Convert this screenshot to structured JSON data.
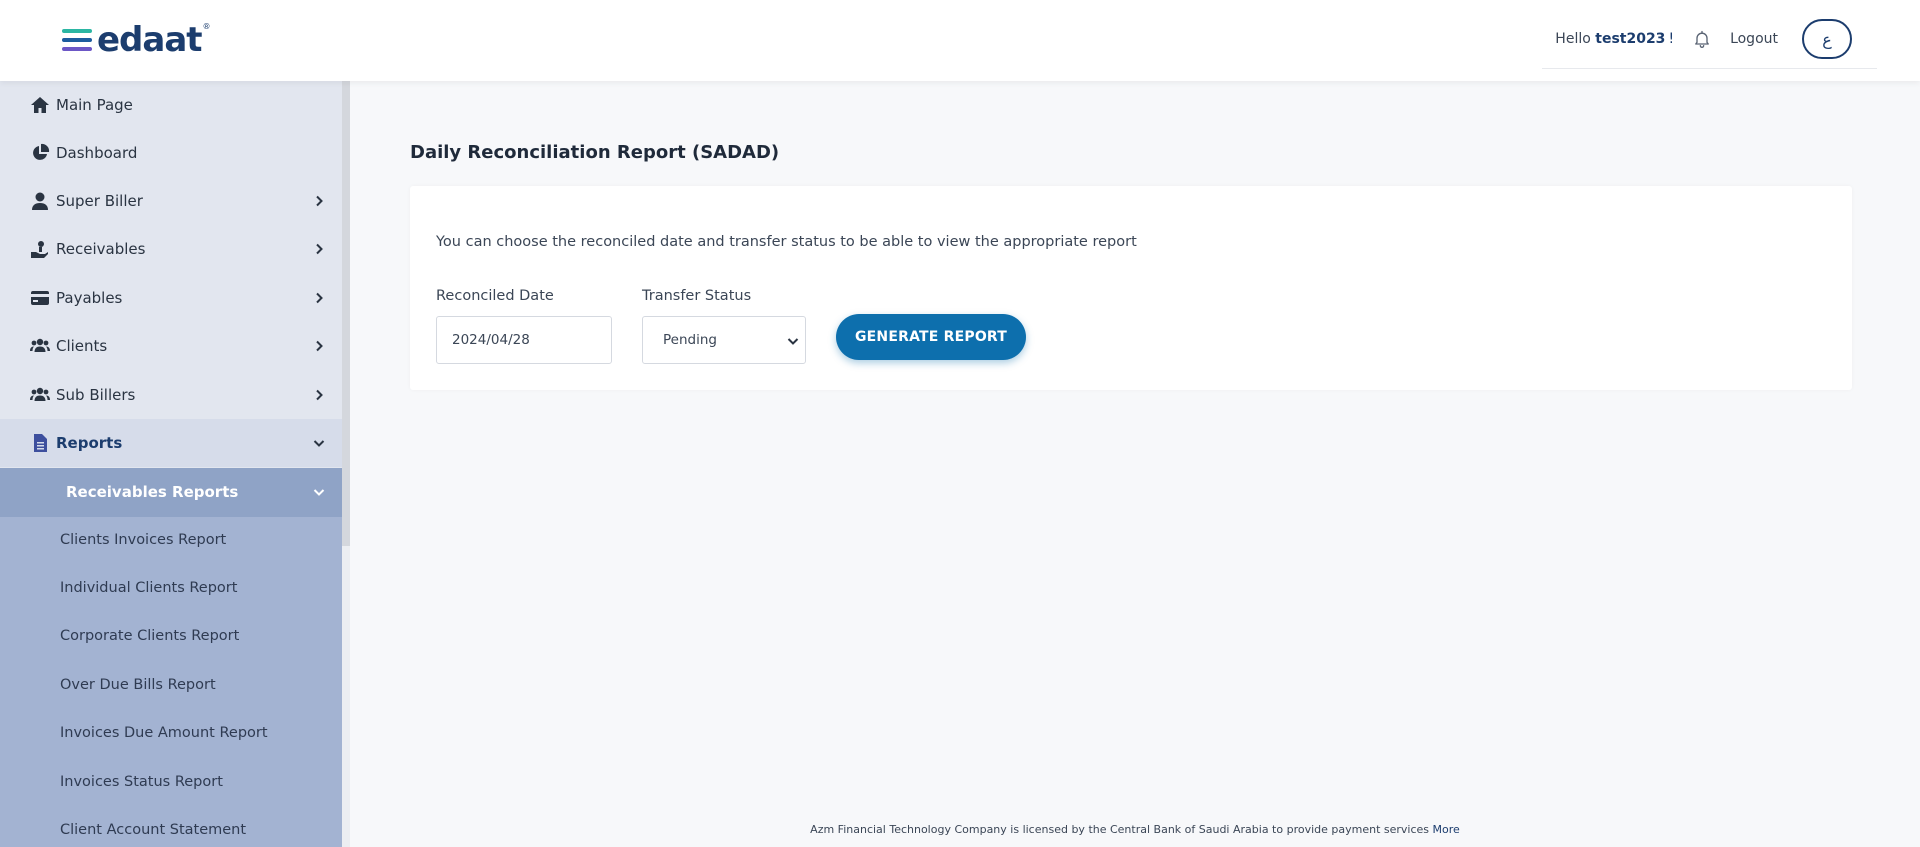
{
  "brand": {
    "logo_text": "edaat",
    "logo_tm": "®",
    "bar_colors": [
      "#2bb6a3",
      "#1c5c9e",
      "#6c57c6"
    ]
  },
  "header": {
    "greeting": "Hello",
    "username": "test2023",
    "greeting_suffix": "!",
    "logout_label": "Logout",
    "language_label": "ع"
  },
  "sidebar": {
    "items": [
      {
        "label": "Main Page",
        "icon": "home-icon",
        "has_chevron": false
      },
      {
        "label": "Dashboard",
        "icon": "pie-chart-icon",
        "has_chevron": false
      },
      {
        "label": "Super Biller",
        "icon": "user-icon",
        "has_chevron": true
      },
      {
        "label": "Receivables",
        "icon": "hand-coin-icon",
        "has_chevron": true
      },
      {
        "label": "Payables",
        "icon": "credit-card-icon",
        "has_chevron": true
      },
      {
        "label": "Clients",
        "icon": "users-icon",
        "has_chevron": true
      },
      {
        "label": "Sub Billers",
        "icon": "users-icon",
        "has_chevron": true
      },
      {
        "label": "Reports",
        "icon": "document-icon",
        "has_chevron": true,
        "expanded": true
      }
    ],
    "submenu_title": "Receivables Reports",
    "submenu_items": [
      "Clients Invoices Report",
      "Individual Clients Report",
      "Corporate Clients Report",
      "Over Due Bills Report",
      "Invoices Due Amount Report",
      "Invoices Status Report",
      "Client Account Statement"
    ]
  },
  "main": {
    "title": "Daily Reconciliation Report (SADAD)",
    "description": "You can choose the reconciled date and transfer status to be able to view the appropriate report",
    "reconciled_date_label": "Reconciled Date",
    "reconciled_date_value": "2024/04/28",
    "transfer_status_label": "Transfer Status",
    "transfer_status_value": "Pending",
    "generate_button": "GENERATE REPORT"
  },
  "footer": {
    "text": "Azm Financial Technology Company is licensed by the Central Bank of Saudi Arabia to provide payment services",
    "link": "More"
  },
  "colors": {
    "primary": "#1c3d6e",
    "button": "#0d6fad",
    "sidebar_bg": "#e2e6ef",
    "submenu_header": "#8fa3c6",
    "submenu_bg": "#a3b3d2"
  }
}
